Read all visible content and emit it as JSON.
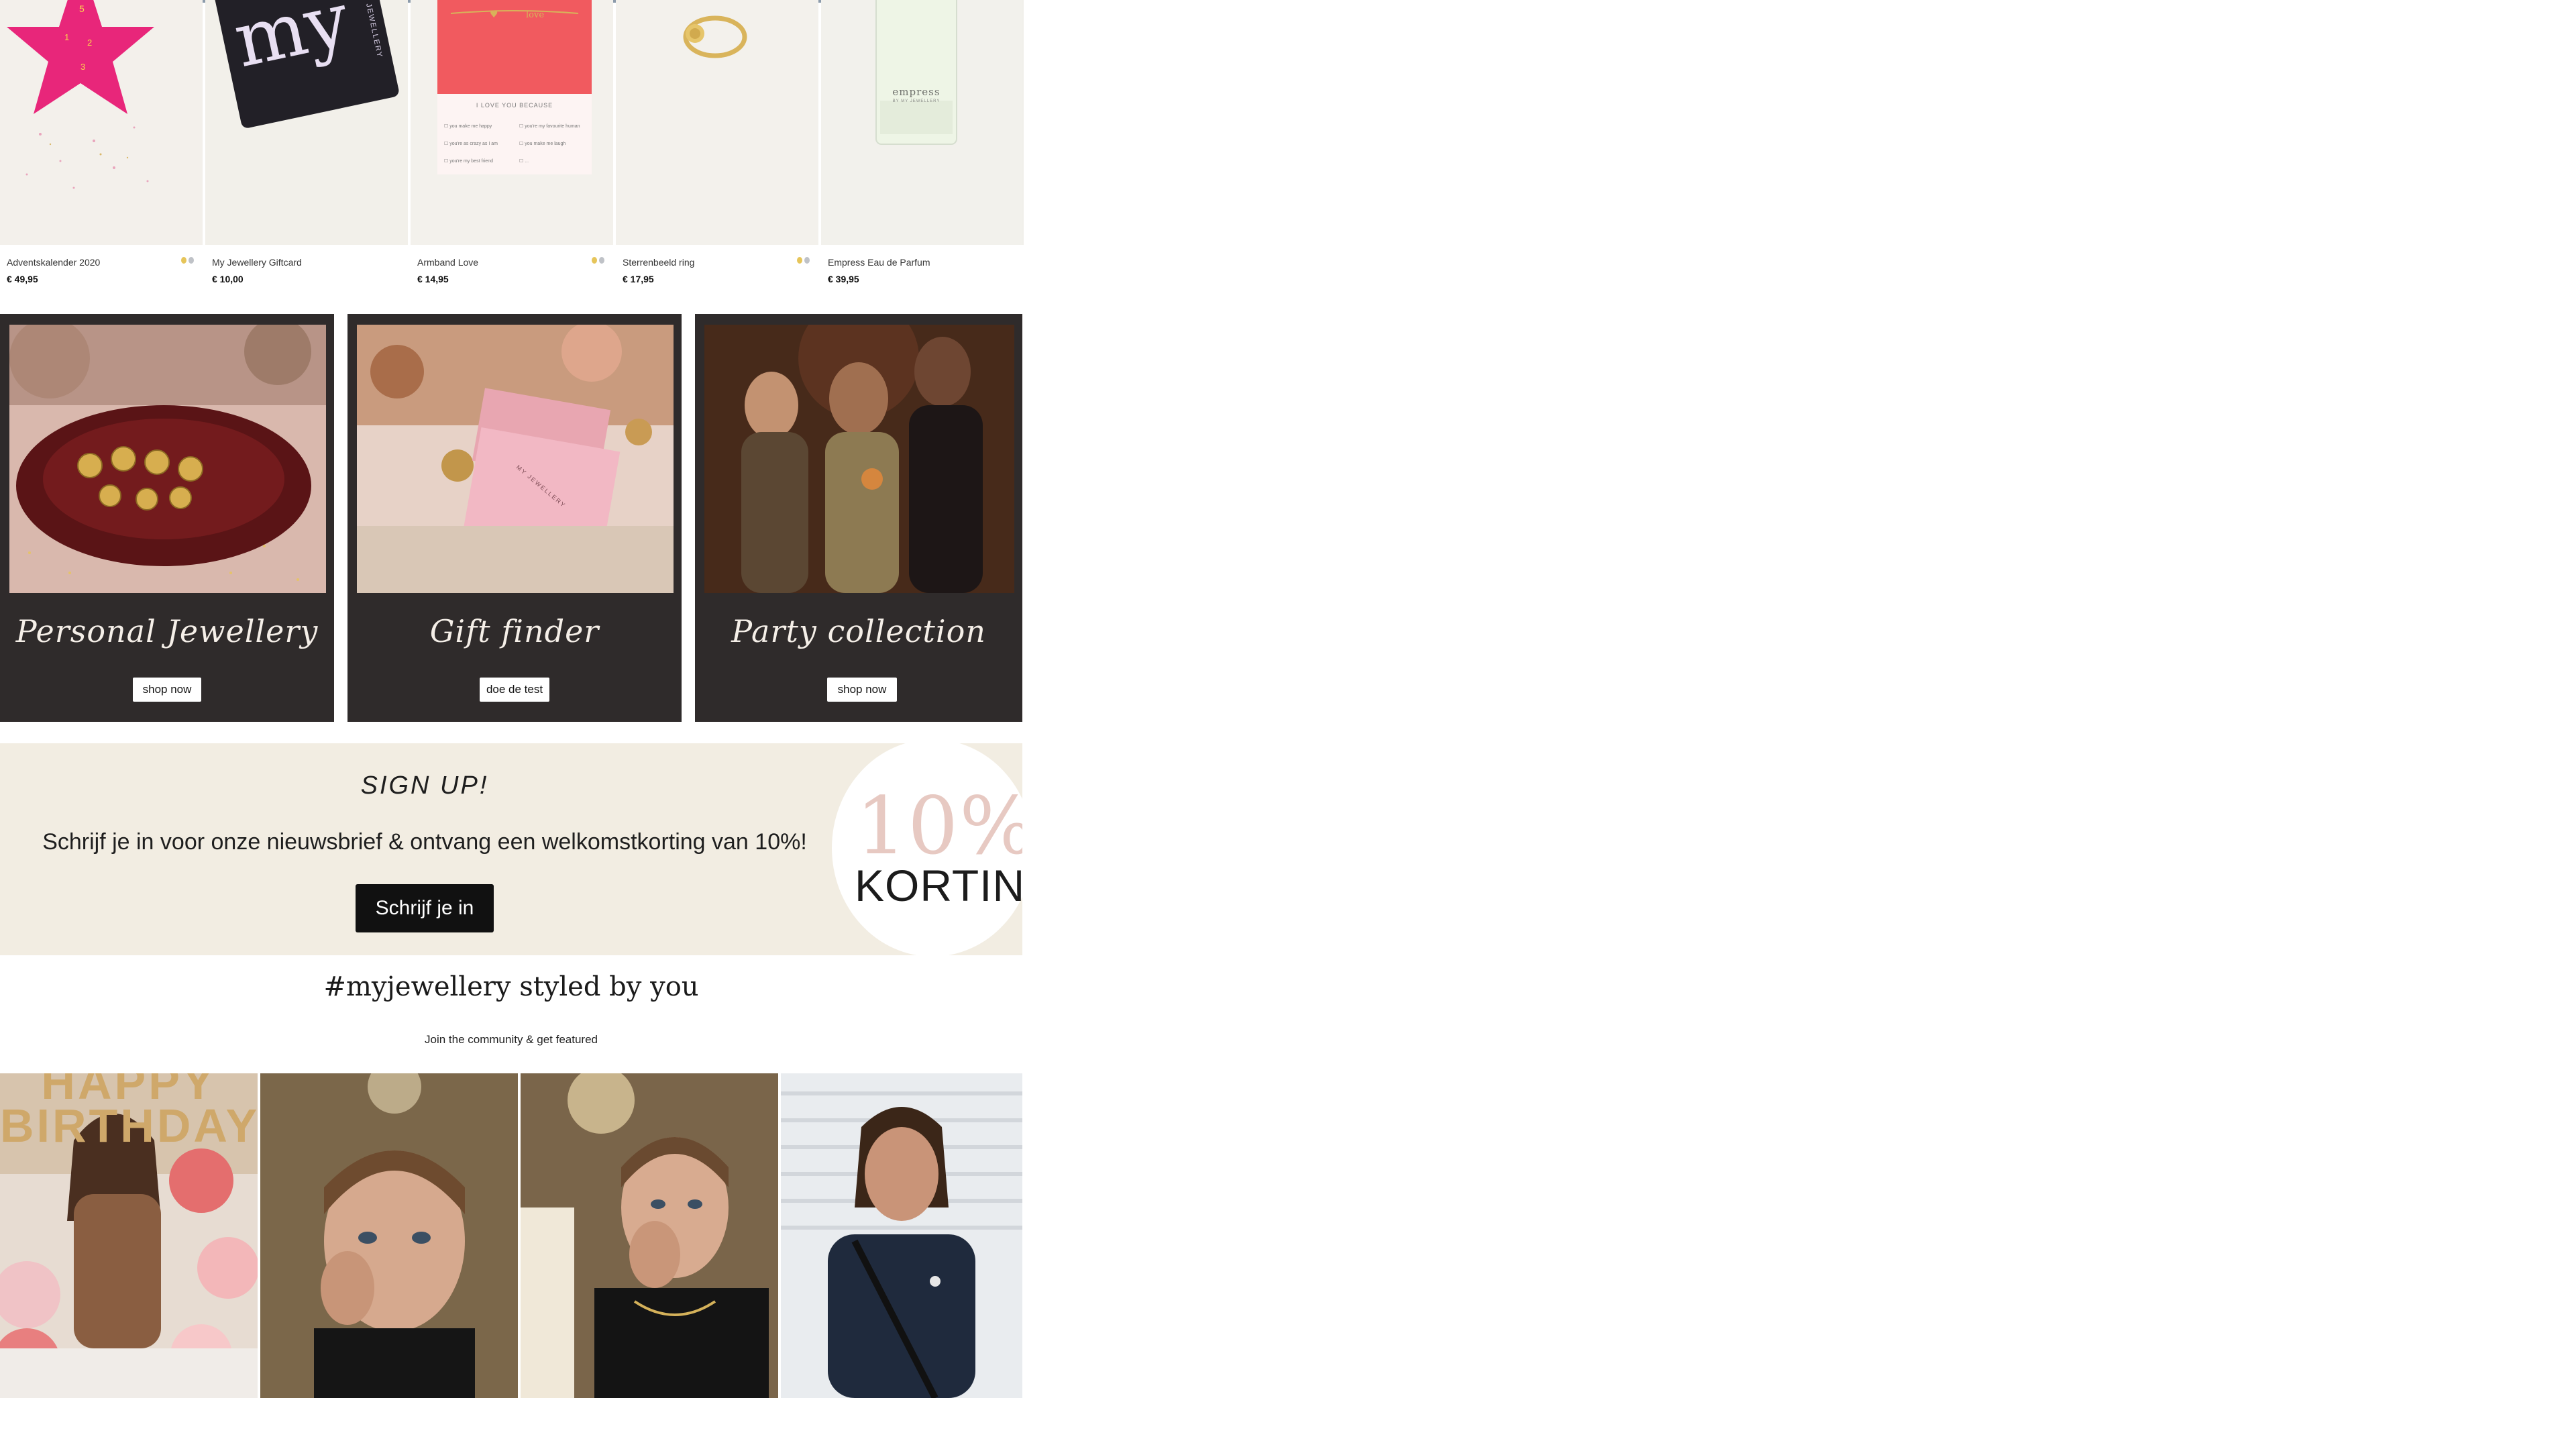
{
  "products": [
    {
      "name": "Adventskalender 2020",
      "price": "€ 49,95",
      "has_swatches": true
    },
    {
      "name": "My Jewellery Giftcard",
      "price": "€ 10,00",
      "has_swatches": false
    },
    {
      "name": "Armband Love",
      "price": "€ 14,95",
      "has_swatches": true
    },
    {
      "name": "Sterrenbeeld ring",
      "price": "€ 17,95",
      "has_swatches": true
    },
    {
      "name": "Empress Eau de Parfum",
      "price": "€ 39,95",
      "has_swatches": false
    }
  ],
  "product_images": {
    "giftcard_text": "my",
    "giftcard_side": "JEWELLERY",
    "love_card_heading": "I LOVE YOU BECAUSE",
    "love_card_items": [
      "you make me happy",
      "you're my favourite human",
      "you're as crazy as I am",
      "you make me laugh",
      "you're my best friend",
      "..."
    ],
    "perfume_brand": "empress",
    "perfume_sub": "BY MY JEWELLERY",
    "calendar_numbers": [
      "5",
      "1",
      "2",
      "3"
    ]
  },
  "promos": [
    {
      "title": "Personal Jewellery",
      "cta": "shop now"
    },
    {
      "title": "Gift finder",
      "cta": "doe de test"
    },
    {
      "title": "Party collection",
      "cta": "shop now"
    }
  ],
  "gift_box_label": "MY JEWELLERY",
  "signup": {
    "heading": "SIGN UP!",
    "text": "Schrijf je in voor onze nieuwsbrief & ontvang een welkomstkorting van 10%!",
    "button": "Schrijf je in",
    "badge_percent": "10%",
    "badge_label": "KORTING"
  },
  "community": {
    "title": "#myjewellery styled by you",
    "subtitle": "Join the community & get featured",
    "balloon_text": "HAPPY BIRTHDAY"
  },
  "colors": {
    "promo_bg": "#2f2b2b",
    "signup_bg": "#f2ede2",
    "product_bg": "#f1f0ea",
    "calendar_pink": "#e8267a"
  }
}
